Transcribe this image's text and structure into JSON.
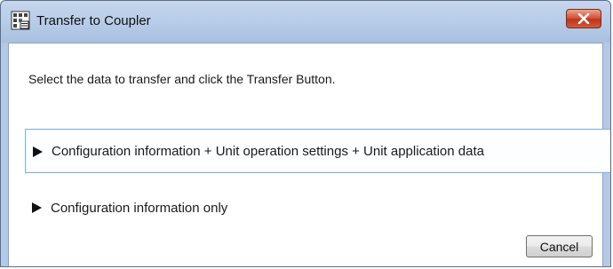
{
  "window": {
    "title": "Transfer to Coupler",
    "app_icon": "grid-window-icon",
    "close_icon": "close-icon"
  },
  "dialog": {
    "instruction": "Select the data to transfer and click the Transfer Button.",
    "options": [
      {
        "label": "Configuration information + Unit operation settings + Unit application data",
        "icon": "expand-arrow-icon",
        "selected": true
      },
      {
        "label": "Configuration information only",
        "icon": "expand-arrow-icon",
        "selected": false
      }
    ],
    "cancel_label": "Cancel"
  },
  "colors": {
    "titlebar": "#b9cde8",
    "close_button": "#c2341c",
    "selection_border": "#7fb2e0"
  }
}
